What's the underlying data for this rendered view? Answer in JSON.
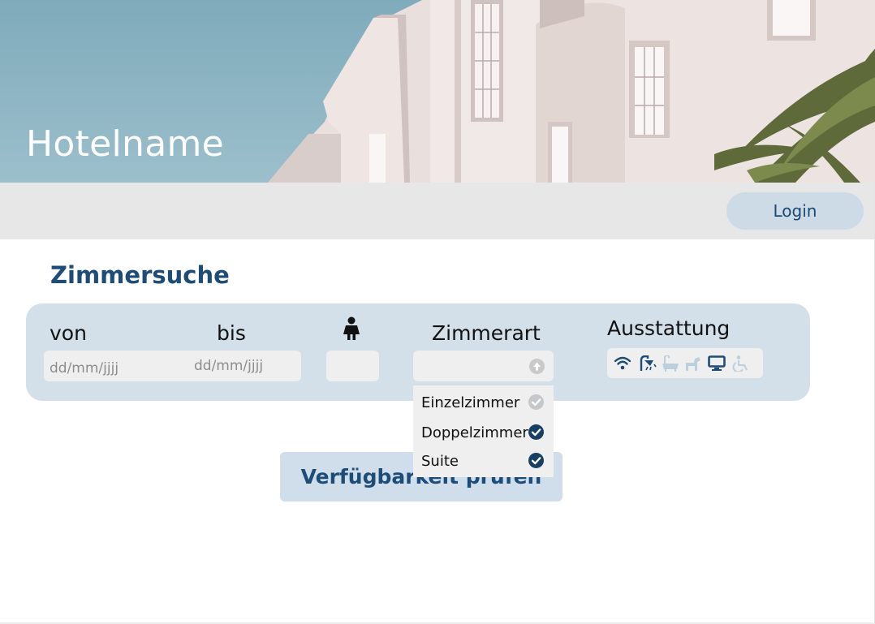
{
  "hero": {
    "hotel_name": "Hotelname",
    "image": "hotel-facade-photo"
  },
  "nav": {
    "login_label": "Login"
  },
  "search": {
    "title": "Zimmersuche",
    "from_label": "von",
    "to_label": "bis",
    "from_placeholder": "dd/mm/jjjj",
    "to_placeholder": "dd/mm/jjjj",
    "guests_icon": "person-icon",
    "guests_value": "",
    "room_type_label": "Zimmerart",
    "room_type_value": "",
    "amenities_label": "Ausstattung",
    "amenities": [
      {
        "icon": "wifi-icon",
        "selected": true
      },
      {
        "icon": "shower-icon",
        "selected": true
      },
      {
        "icon": "bathtub-icon",
        "selected": false
      },
      {
        "icon": "dog-icon",
        "selected": false
      },
      {
        "icon": "tv-icon",
        "selected": true
      },
      {
        "icon": "wheelchair-icon",
        "selected": false
      }
    ],
    "room_types": [
      {
        "label": "Einzelzimmer",
        "checked": false
      },
      {
        "label": "Doppelzimmer",
        "checked": true
      },
      {
        "label": "Suite",
        "checked": true
      }
    ],
    "submit_label": "Verfügbarkeit prüfen"
  },
  "colors": {
    "primary": "#1c4c77",
    "panel": "#d3e0ea",
    "field": "#efefef",
    "nav": "#e7e7e7",
    "icon_inactive": "#bccfdd"
  }
}
